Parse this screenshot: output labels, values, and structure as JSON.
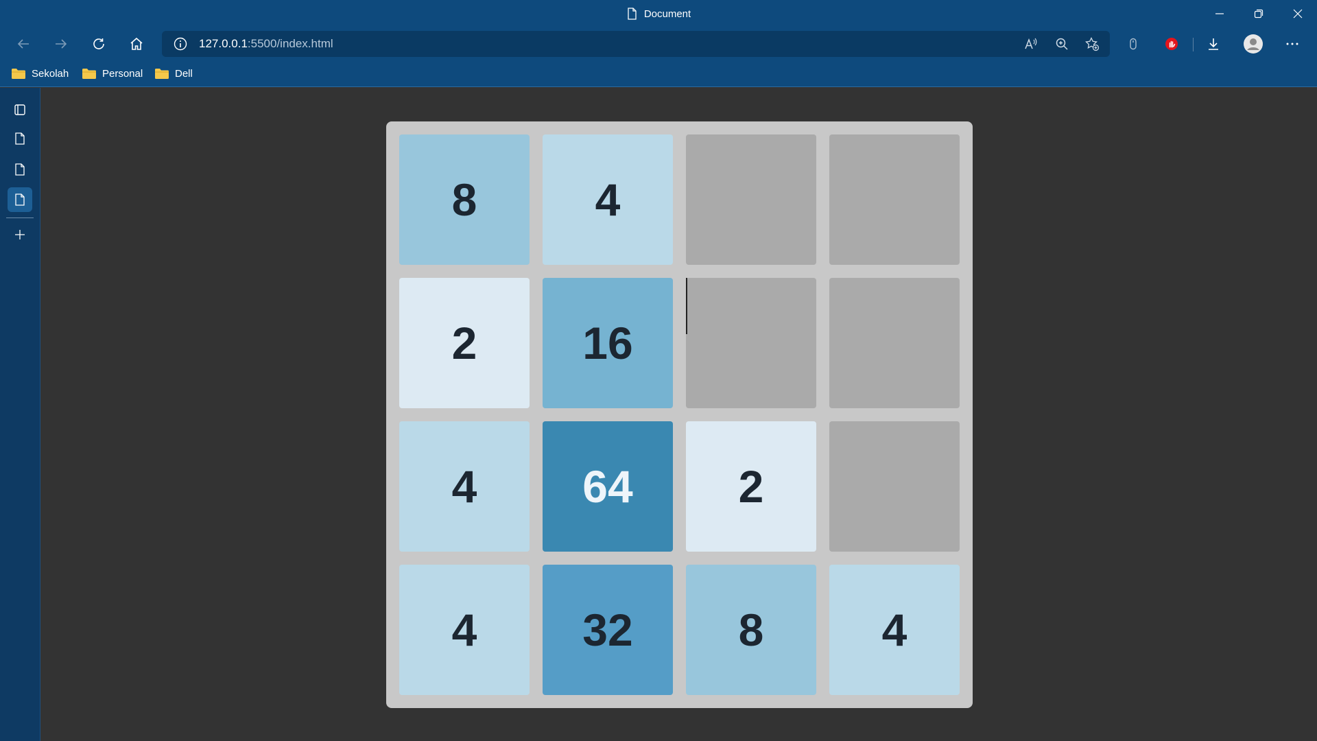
{
  "window": {
    "title": "Document",
    "controls": [
      "minimize",
      "restore",
      "close"
    ]
  },
  "nav": {
    "url_host": "127.0.0.1",
    "url_path": ":5500/index.html"
  },
  "bookmarks": [
    {
      "label": "Sekolah",
      "icon": "folder-icon"
    },
    {
      "label": "Personal",
      "icon": "folder-icon"
    },
    {
      "label": "Dell",
      "icon": "folder-icon"
    }
  ],
  "sidebar": {
    "items": [
      "tab-actions-icon",
      "page-icon",
      "page-icon",
      "page-icon-active"
    ],
    "add": "plus-icon"
  },
  "colors": {
    "chrome": "#0e4a7d",
    "address_bar": "#0a3a63",
    "page_background": "#333333",
    "board": "#c8c8c8",
    "empty": "#aaaaaa",
    "t2": "#ddeaf3",
    "t4": "#bad9e8",
    "t8": "#98c6dc",
    "t16": "#76b3d1",
    "t32": "#559dc7",
    "t64": "#3a88b1"
  },
  "game": {
    "grid": [
      [
        "8",
        "4",
        "",
        ""
      ],
      [
        "2",
        "16",
        "",
        ""
      ],
      [
        "4",
        "64",
        "2",
        ""
      ],
      [
        "4",
        "32",
        "8",
        "4"
      ]
    ]
  }
}
